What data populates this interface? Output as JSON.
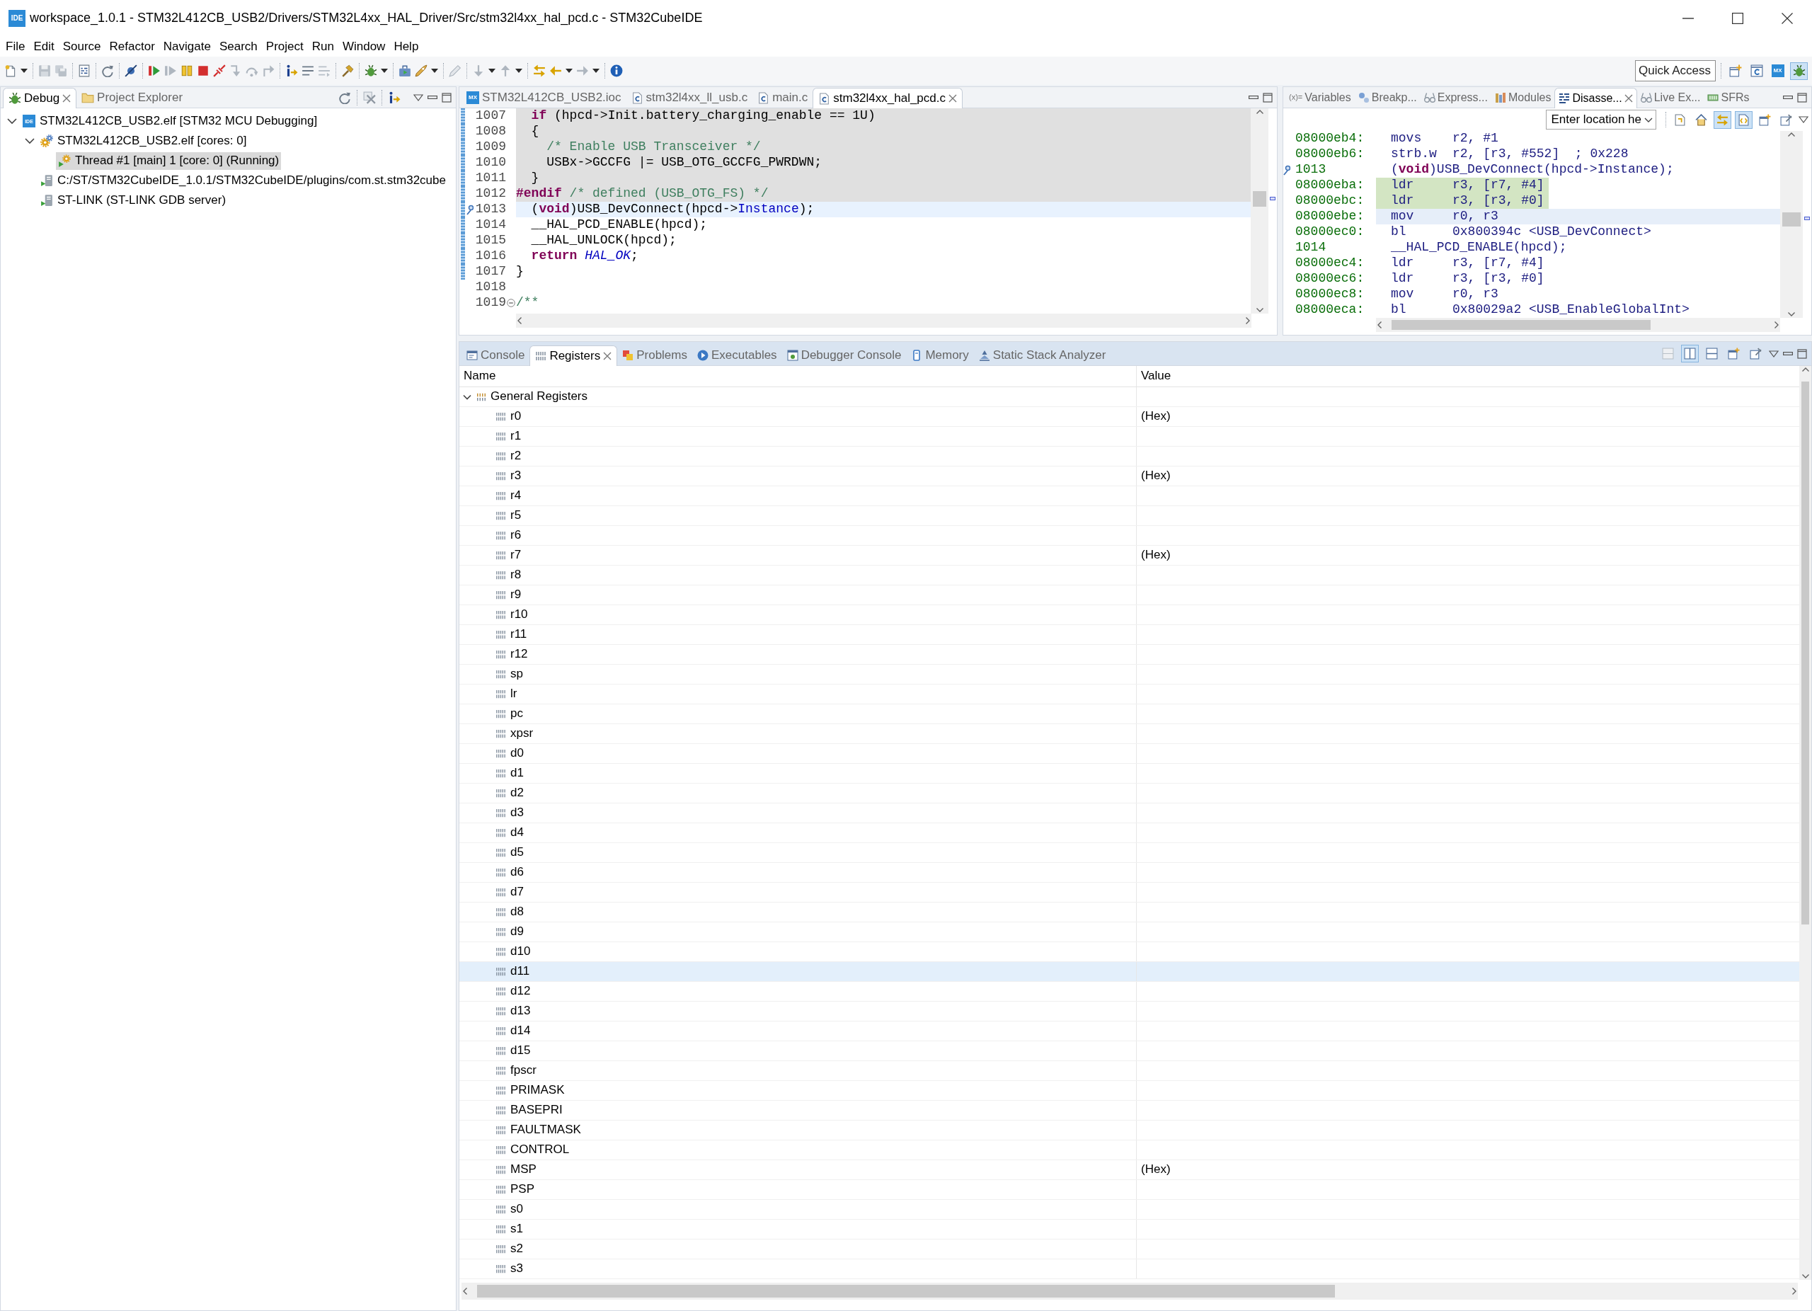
{
  "window": {
    "icon_label": "IDE",
    "title": "workspace_1.0.1 - STM32L412CB_USB2/Drivers/STM32L4xx_HAL_Driver/Src/stm32l4xx_hal_pcd.c - STM32CubeIDE"
  },
  "menu": [
    "File",
    "Edit",
    "Source",
    "Refactor",
    "Navigate",
    "Search",
    "Project",
    "Run",
    "Window",
    "Help"
  ],
  "toolbar": {
    "quick_access": {
      "placeholder": "Quick Access"
    },
    "perspectives": [
      {
        "kind": "open",
        "selected": false
      },
      {
        "kind": "cpp",
        "selected": false
      },
      {
        "kind": "mx",
        "icon_label": "MX",
        "selected": false
      },
      {
        "kind": "debug",
        "selected": true
      }
    ]
  },
  "debug_view": {
    "tabs": [
      {
        "kind": "debug",
        "label": "Debug",
        "selected": true
      },
      {
        "kind": "explorer",
        "label": "Project Explorer",
        "selected": false
      }
    ],
    "tree": [
      {
        "kind": "launch",
        "icon_label": "IDE",
        "label": "STM32L412CB_USB2.elf [STM32 MCU Debugging]",
        "expanded": true,
        "selected": false,
        "children": [
          {
            "kind": "process",
            "label": "STM32L412CB_USB2.elf [cores: 0]",
            "expanded": true,
            "selected": false,
            "children": [
              {
                "kind": "thread",
                "label": "Thread #1 [main] 1 [core: 0] (Running)",
                "selected": true
              }
            ]
          },
          {
            "kind": "server",
            "label": "C:/ST/STM32CubeIDE_1.0.1/STM32CubeIDE/plugins/com.st.stm32cube",
            "selected": false
          },
          {
            "kind": "server",
            "label": "ST-LINK (ST-LINK GDB server)",
            "selected": false
          }
        ]
      }
    ]
  },
  "editor": {
    "tabs": [
      {
        "kind": "mx",
        "icon_label": "MX",
        "label": "STM32L412CB_USB2.ioc",
        "selected": false
      },
      {
        "kind": "c",
        "label": "stm32l4xx_ll_usb.c",
        "selected": false
      },
      {
        "kind": "c",
        "label": "main.c",
        "selected": false
      },
      {
        "kind": "c",
        "label": "stm32l4xx_hal_pcd.c",
        "selected": true
      }
    ],
    "lines": [
      {
        "number": "1007",
        "inactive": true,
        "current": false,
        "in_range": true,
        "pointer": false,
        "foldable": false,
        "code": [
          {
            "kind": "keyword",
            "text": "  if"
          },
          {
            "kind": "plain",
            "text": " (hpcd->Init.battery_charging_enable == 1U)"
          }
        ]
      },
      {
        "number": "1008",
        "inactive": true,
        "current": false,
        "in_range": true,
        "pointer": false,
        "foldable": false,
        "code": [
          {
            "kind": "plain",
            "text": "  {"
          }
        ]
      },
      {
        "number": "1009",
        "inactive": true,
        "current": false,
        "in_range": true,
        "pointer": false,
        "foldable": false,
        "code": [
          {
            "kind": "comment",
            "text": "    /* Enable USB Transceiver */"
          }
        ]
      },
      {
        "number": "1010",
        "inactive": true,
        "current": false,
        "in_range": true,
        "pointer": false,
        "foldable": false,
        "code": [
          {
            "kind": "plain",
            "text": "    USBx->GCCFG |= USB_OTG_GCCFG_PWRDWN;"
          }
        ]
      },
      {
        "number": "1011",
        "inactive": true,
        "current": false,
        "in_range": true,
        "pointer": false,
        "foldable": false,
        "code": [
          {
            "kind": "plain",
            "text": "  }"
          }
        ]
      },
      {
        "number": "1012",
        "inactive": true,
        "current": false,
        "in_range": true,
        "pointer": false,
        "foldable": false,
        "code": [
          {
            "kind": "keyword",
            "text": "#endif"
          },
          {
            "kind": "comment",
            "text": " /* defined (USB_OTG_FS) */"
          }
        ]
      },
      {
        "number": "1013",
        "inactive": false,
        "current": true,
        "in_range": true,
        "pointer": true,
        "foldable": false,
        "code": [
          {
            "kind": "plain",
            "text": "  ("
          },
          {
            "kind": "keyword",
            "text": "void"
          },
          {
            "kind": "plain",
            "text": ")USB_DevConnect(hpcd->"
          },
          {
            "kind": "field",
            "text": "Instance"
          },
          {
            "kind": "plain",
            "text": ");"
          }
        ]
      },
      {
        "number": "1014",
        "inactive": false,
        "current": false,
        "in_range": true,
        "pointer": false,
        "foldable": false,
        "code": [
          {
            "kind": "plain",
            "text": "  __HAL_PCD_ENABLE(hpcd);"
          }
        ]
      },
      {
        "number": "1015",
        "inactive": false,
        "current": false,
        "in_range": true,
        "pointer": false,
        "foldable": false,
        "code": [
          {
            "kind": "plain",
            "text": "  __HAL_UNLOCK(hpcd);"
          }
        ]
      },
      {
        "number": "1016",
        "inactive": false,
        "current": false,
        "in_range": true,
        "pointer": false,
        "foldable": false,
        "code": [
          {
            "kind": "keyword",
            "text": "  return"
          },
          {
            "kind": "constant",
            "text": " HAL_OK"
          },
          {
            "kind": "plain",
            "text": ";"
          }
        ]
      },
      {
        "number": "1017",
        "inactive": false,
        "current": false,
        "in_range": true,
        "pointer": false,
        "foldable": false,
        "code": [
          {
            "kind": "plain",
            "text": "}"
          }
        ]
      },
      {
        "number": "1018",
        "inactive": false,
        "current": false,
        "in_range": false,
        "pointer": false,
        "foldable": false
      },
      {
        "number": "1019",
        "inactive": false,
        "current": false,
        "in_range": false,
        "pointer": false,
        "foldable": true,
        "code": [
          {
            "kind": "comment",
            "text": "/**"
          }
        ]
      }
    ]
  },
  "disassembly": {
    "tabs": [
      {
        "kind": "variables",
        "icon_label": "(x)=",
        "label": "Variables",
        "selected": false
      },
      {
        "kind": "breakpoints",
        "label": "Breakp...",
        "selected": false
      },
      {
        "kind": "expressions",
        "label": "Express...",
        "selected": false
      },
      {
        "kind": "modules",
        "label": "Modules",
        "selected": false
      },
      {
        "kind": "disassembly",
        "label": "Disasse...",
        "selected": true
      },
      {
        "kind": "live",
        "label": "Live Ex...",
        "selected": false
      },
      {
        "kind": "sfrs",
        "label": "SFRs",
        "selected": false
      }
    ],
    "location_field": {
      "value": "Enter location he"
    },
    "toolbar": [
      {
        "kind": "page",
        "pressed": false
      },
      {
        "kind": "home",
        "pressed": false
      },
      {
        "kind": "link",
        "pressed": true
      },
      {
        "kind": "source",
        "pressed": true
      },
      {
        "kind": "new_window",
        "pressed": false
      },
      {
        "kind": "pin",
        "pressed": false
      }
    ],
    "rows": [
      {
        "kind": "instruction",
        "address": "08000eb4:",
        "mnemonic": "movs",
        "operands": "r2, #1",
        "marked": false,
        "current": false,
        "pointer": false
      },
      {
        "kind": "instruction",
        "address": "08000eb6:",
        "mnemonic": "strb.w",
        "operands": "r2, [r3, #552]  ; 0x228",
        "marked": false,
        "current": false,
        "pointer": false
      },
      {
        "kind": "source",
        "line": "1013",
        "code": [
          {
            "kind": "plain",
            "text": "("
          },
          {
            "kind": "keyword",
            "text": "void"
          },
          {
            "kind": "plain",
            "text": ")USB_DevConnect(hpcd->Instance);"
          }
        ],
        "marked": false,
        "current": false,
        "pointer": true
      },
      {
        "kind": "instruction",
        "address": "08000eba:",
        "mnemonic": "ldr",
        "operands": "r3, [r7, #4]",
        "marked": true,
        "current": false,
        "pointer": false
      },
      {
        "kind": "instruction",
        "address": "08000ebc:",
        "mnemonic": "ldr",
        "operands": "r3, [r3, #0]",
        "marked": true,
        "current": false,
        "pointer": false
      },
      {
        "kind": "instruction",
        "address": "08000ebe:",
        "mnemonic": "mov",
        "operands": "r0, r3",
        "marked": false,
        "current": true,
        "pointer": false
      },
      {
        "kind": "instruction",
        "address": "08000ec0:",
        "mnemonic": "bl",
        "operands": "0x800394c <USB_DevConnect>",
        "marked": false,
        "current": false,
        "pointer": false
      },
      {
        "kind": "source",
        "line": "1014",
        "code": [
          {
            "kind": "plain",
            "text": "__HAL_PCD_ENABLE(hpcd);"
          }
        ],
        "marked": false,
        "current": false,
        "pointer": false
      },
      {
        "kind": "instruction",
        "address": "08000ec4:",
        "mnemonic": "ldr",
        "operands": "r3, [r7, #4]",
        "marked": false,
        "current": false,
        "pointer": false
      },
      {
        "kind": "instruction",
        "address": "08000ec6:",
        "mnemonic": "ldr",
        "operands": "r3, [r3, #0]",
        "marked": false,
        "current": false,
        "pointer": false
      },
      {
        "kind": "instruction",
        "address": "08000ec8:",
        "mnemonic": "mov",
        "operands": "r0, r3",
        "marked": false,
        "current": false,
        "pointer": false
      },
      {
        "kind": "instruction",
        "address": "08000eca:",
        "mnemonic": "bl",
        "operands": "0x80029a2 <USB_EnableGlobalInt>",
        "marked": false,
        "current": false,
        "pointer": false
      }
    ]
  },
  "registers_view": {
    "tabs": [
      {
        "kind": "console",
        "label": "Console",
        "selected": false
      },
      {
        "kind": "registers",
        "label": "Registers",
        "selected": true
      },
      {
        "kind": "problems",
        "label": "Problems",
        "selected": false
      },
      {
        "kind": "executables",
        "label": "Executables",
        "selected": false
      },
      {
        "kind": "debugger_console",
        "label": "Debugger Console",
        "selected": false
      },
      {
        "kind": "memory",
        "label": "Memory",
        "selected": false
      },
      {
        "kind": "stack",
        "label": "Static Stack Analyzer",
        "selected": false
      }
    ],
    "toolbar": [
      {
        "kind": "layout",
        "pressed": false
      },
      {
        "kind": "split_vertical",
        "pressed": true
      },
      {
        "kind": "split_horizontal",
        "pressed": false
      },
      {
        "kind": "new_window",
        "pressed": false
      },
      {
        "kind": "pin",
        "pressed": false
      }
    ],
    "columns": [
      "Name",
      "Value"
    ],
    "groups": [
      {
        "label": "General Registers",
        "expanded": true,
        "registers": [
          {
            "name": "r0",
            "value": "(Hex)",
            "selected": false
          },
          {
            "name": "r1",
            "selected": false
          },
          {
            "name": "r2",
            "selected": false
          },
          {
            "name": "r3",
            "value": "(Hex)",
            "selected": false
          },
          {
            "name": "r4",
            "selected": false
          },
          {
            "name": "r5",
            "selected": false
          },
          {
            "name": "r6",
            "selected": false
          },
          {
            "name": "r7",
            "value": "(Hex)",
            "selected": false
          },
          {
            "name": "r8",
            "selected": false
          },
          {
            "name": "r9",
            "selected": false
          },
          {
            "name": "r10",
            "selected": false
          },
          {
            "name": "r11",
            "selected": false
          },
          {
            "name": "r12",
            "selected": false
          },
          {
            "name": "sp",
            "selected": false
          },
          {
            "name": "lr",
            "selected": false
          },
          {
            "name": "pc",
            "selected": false
          },
          {
            "name": "xpsr",
            "selected": false
          },
          {
            "name": "d0",
            "selected": false
          },
          {
            "name": "d1",
            "selected": false
          },
          {
            "name": "d2",
            "selected": false
          },
          {
            "name": "d3",
            "selected": false
          },
          {
            "name": "d4",
            "selected": false
          },
          {
            "name": "d5",
            "selected": false
          },
          {
            "name": "d6",
            "selected": false
          },
          {
            "name": "d7",
            "selected": false
          },
          {
            "name": "d8",
            "selected": false
          },
          {
            "name": "d9",
            "selected": false
          },
          {
            "name": "d10",
            "selected": false
          },
          {
            "name": "d11",
            "selected": true
          },
          {
            "name": "d12",
            "selected": false
          },
          {
            "name": "d13",
            "selected": false
          },
          {
            "name": "d14",
            "selected": false
          },
          {
            "name": "d15",
            "selected": false
          },
          {
            "name": "fpscr",
            "selected": false
          },
          {
            "name": "PRIMASK",
            "selected": false
          },
          {
            "name": "BASEPRI",
            "selected": false
          },
          {
            "name": "FAULTMASK",
            "selected": false
          },
          {
            "name": "CONTROL",
            "selected": false
          },
          {
            "name": "MSP",
            "value": "(Hex)",
            "selected": false
          },
          {
            "name": "PSP",
            "selected": false
          },
          {
            "name": "s0",
            "selected": false
          },
          {
            "name": "s1",
            "selected": false
          },
          {
            "name": "s2",
            "selected": false
          },
          {
            "name": "s3",
            "selected": false
          }
        ]
      }
    ]
  }
}
